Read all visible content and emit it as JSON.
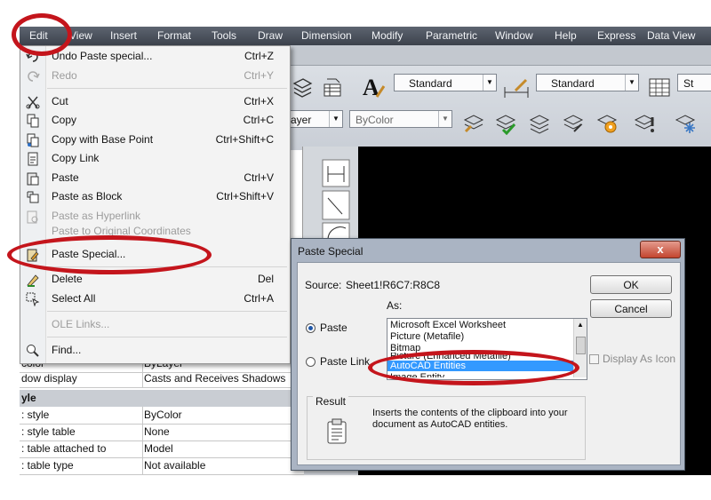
{
  "menubar": {
    "items": [
      "Edit",
      "View",
      "Insert",
      "Format",
      "Tools",
      "Draw",
      "Dimension",
      "Modify",
      "Parametric",
      "Window",
      "Help",
      "Express",
      "Data View"
    ]
  },
  "toolbar": {
    "text_style": "Standard",
    "dim_style": "Standard",
    "table_style_partial": "St",
    "layer_partial": "ayer",
    "color": "ByColor"
  },
  "edit_menu": {
    "items": [
      {
        "label": "Undo Paste special...",
        "shortcut": "Ctrl+Z",
        "disabled": false,
        "icon": "undo-icon"
      },
      {
        "label": "Redo",
        "shortcut": "Ctrl+Y",
        "disabled": true,
        "icon": "redo-icon"
      },
      {
        "label": "Cut",
        "shortcut": "Ctrl+X",
        "disabled": false,
        "icon": "scissors-icon"
      },
      {
        "label": "Copy",
        "shortcut": "Ctrl+C",
        "disabled": false,
        "icon": "copy-icon"
      },
      {
        "label": "Copy with Base Point",
        "shortcut": "Ctrl+Shift+C",
        "disabled": false,
        "icon": "copy-base-point-icon"
      },
      {
        "label": "Copy Link",
        "shortcut": "",
        "disabled": false,
        "icon": "copy-link-icon"
      },
      {
        "label": "Paste",
        "shortcut": "Ctrl+V",
        "disabled": false,
        "icon": "paste-icon"
      },
      {
        "label": "Paste as Block",
        "shortcut": "Ctrl+Shift+V",
        "disabled": false,
        "icon": "paste-block-icon"
      },
      {
        "label": "Paste as Hyperlink",
        "shortcut": "",
        "disabled": true,
        "icon": "paste-hyperlink-icon"
      },
      {
        "label": "Paste to Original Coordinates",
        "shortcut": "",
        "disabled": true,
        "icon": "paste-coordinates-icon"
      },
      {
        "label": "Paste Special...",
        "shortcut": "",
        "disabled": false,
        "icon": "paste-special-icon"
      },
      {
        "label": "Delete",
        "shortcut": "Del",
        "disabled": false,
        "icon": "eraser-icon"
      },
      {
        "label": "Select All",
        "shortcut": "Ctrl+A",
        "disabled": false,
        "icon": "select-all-icon"
      },
      {
        "label": "OLE Links...",
        "shortcut": "",
        "disabled": true,
        "icon": ""
      },
      {
        "label": "Find...",
        "shortcut": "",
        "disabled": false,
        "icon": "find-icon"
      }
    ]
  },
  "properties": {
    "rows": [
      {
        "key": "color",
        "value": "ByLayer",
        "section": false
      },
      {
        "key": "dow display",
        "value": "Casts and Receives Shadows",
        "section": false
      },
      {
        "key": "yle",
        "value": "",
        "section": true
      },
      {
        "key": ": style",
        "value": "ByColor",
        "section": false
      },
      {
        "key": ": style table",
        "value": "None",
        "section": false
      },
      {
        "key": ": table attached to",
        "value": "Model",
        "section": false
      },
      {
        "key": ": table type",
        "value": "Not available",
        "section": false
      }
    ]
  },
  "dialog": {
    "title": "Paste Special",
    "close_label": "x",
    "source_label": "Source:",
    "source_value": "Sheet1!R6C7:R8C8",
    "as_label": "As:",
    "paste_label": "Paste",
    "paste_link_label": "Paste Link",
    "ok_label": "OK",
    "cancel_label": "Cancel",
    "display_as_icon_label": "Display As Icon",
    "list_items": [
      "Microsoft Excel Worksheet",
      "Picture (Metafile)",
      "Bitmap",
      "Picture (Enhanced Metafile)",
      "AutoCAD Entities",
      "Image Entity"
    ],
    "selected_index": 4,
    "result_label": "Result",
    "result_text": "Inserts the contents of the clipboard into your document as AutoCAD entities."
  },
  "colors": {
    "highlight_red": "#c4151c",
    "selection_blue": "#3399ff",
    "menubar": "#4a505a"
  }
}
